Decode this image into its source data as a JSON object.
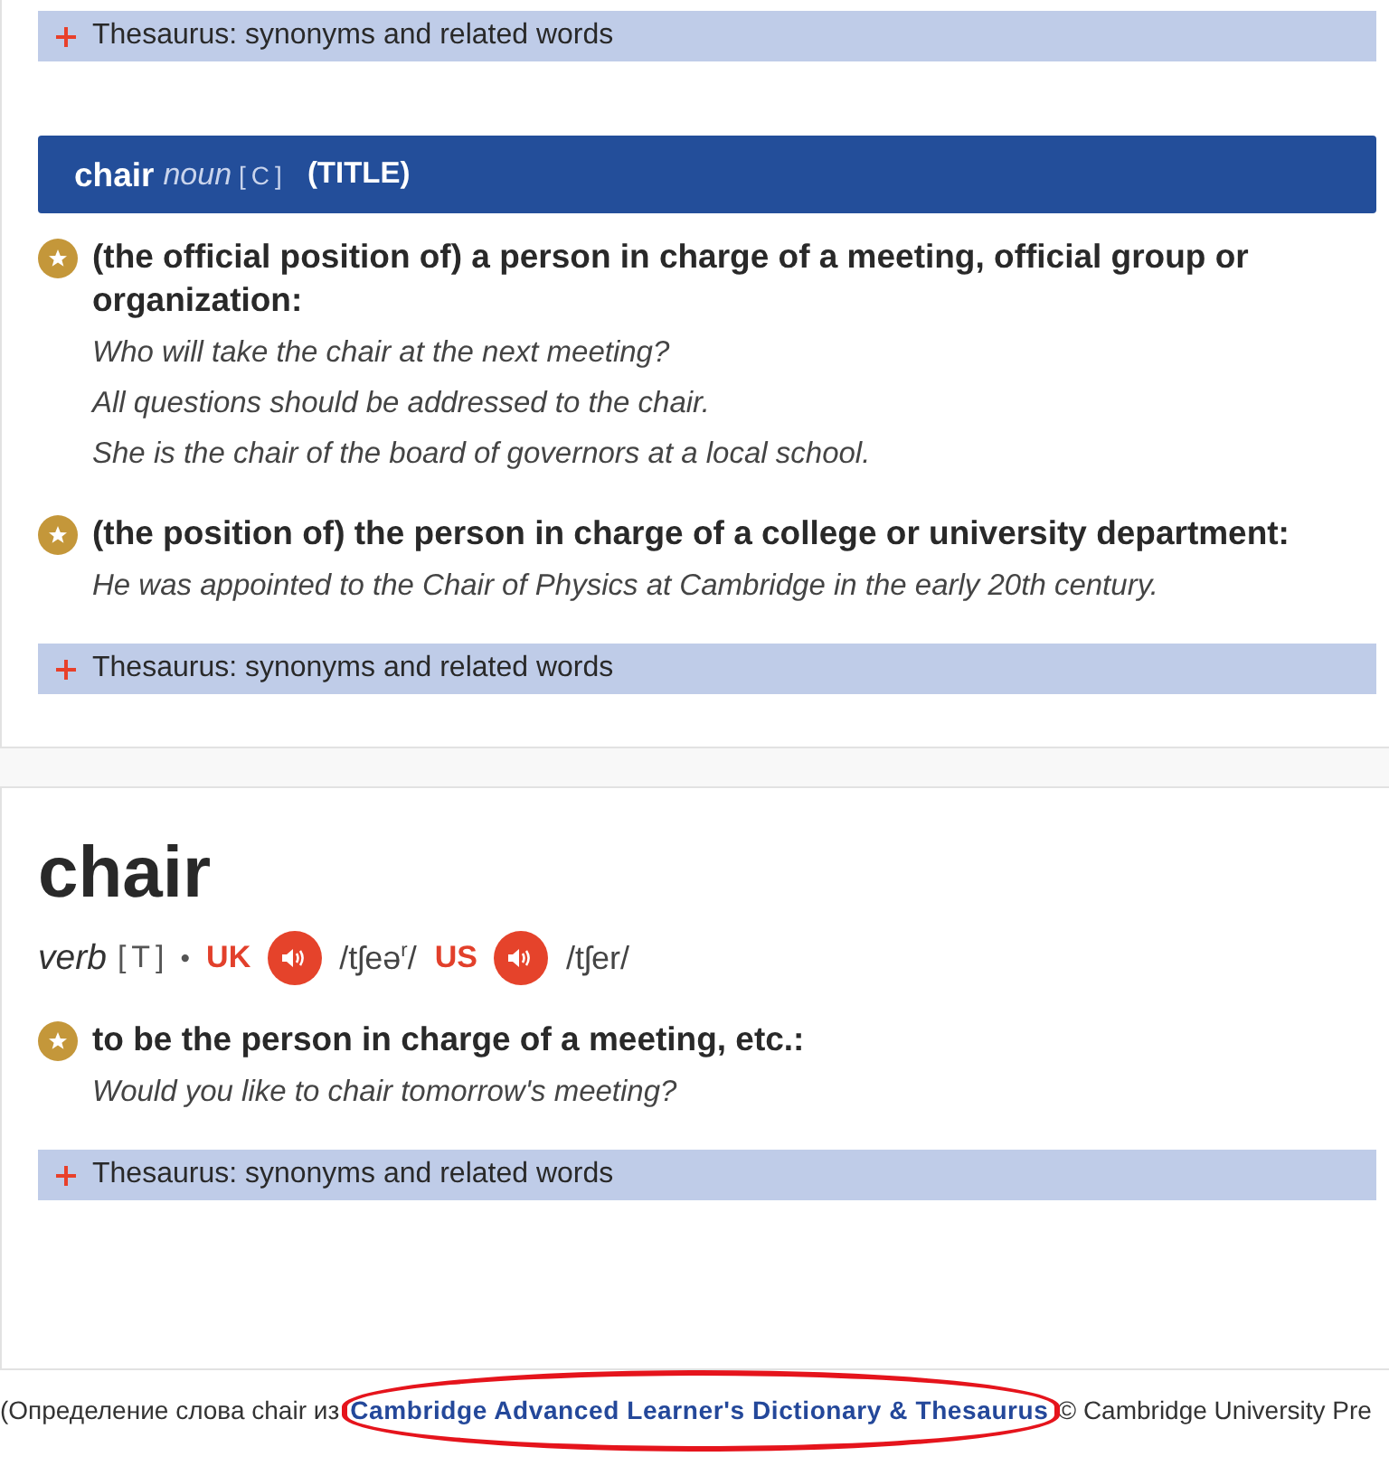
{
  "top_thesaurus": {
    "label": "Thesaurus: synonyms and related words",
    "expanded": false
  },
  "noun_block": {
    "header": {
      "headword": "chair",
      "pos": "noun",
      "grammar": "[C]",
      "guideword": "(TITLE)"
    },
    "senses": [
      {
        "definition": "(the official position of) a person in charge of a meeting, official group or organization:",
        "examples": [
          "Who will take the chair at the next meeting?",
          "All questions should be addressed to the chair.",
          "She is the chair of the board of governors at a local school."
        ]
      },
      {
        "definition": "(the position of) the person in charge of a college or university department:",
        "examples": [
          "He was appointed to the Chair of Physics at Cambridge in the early 20th century."
        ]
      }
    ],
    "thesaurus": {
      "label": "Thesaurus: synonyms and related words",
      "expanded": false
    }
  },
  "verb_entry": {
    "headword": "chair",
    "pos": "verb",
    "grammar": "[T]",
    "separator": "•",
    "pronunciations": [
      {
        "region": "UK",
        "ipa": "/tʃeə$^{r}$/"
      },
      {
        "region": "US",
        "ipa": "/tʃer/"
      }
    ],
    "senses": [
      {
        "definition": "to be the person in charge of a meeting, etc.:",
        "examples": [
          "Would you like to chair tomorrow's meeting?"
        ]
      }
    ],
    "thesaurus": {
      "label": "Thesaurus: synonyms and related words",
      "expanded": false
    }
  },
  "footer": {
    "prefix": "(Определение слова chair из",
    "link": "Cambridge Advanced Learner's Dictionary & Thesaurus",
    "suffix": "© Cambridge University Pre"
  }
}
